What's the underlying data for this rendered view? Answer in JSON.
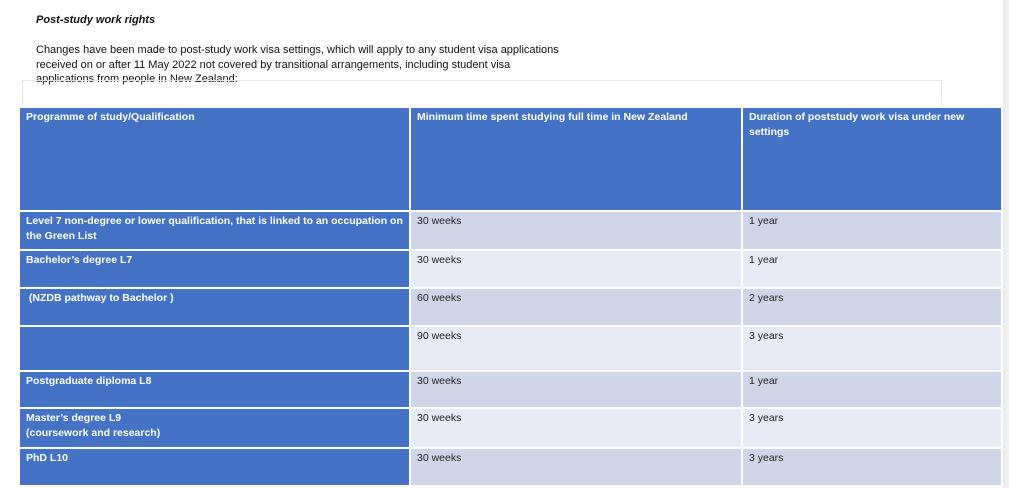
{
  "heading": "Post-study work rights",
  "intro": {
    "line1": "Changes have been made to post-study work visa settings, which will apply to any student visa applications",
    "line2": "received on or after 11 May 2022 not covered by transitional arrangements, including student visa",
    "line3": "applications from people in New Zealand:"
  },
  "table": {
    "headers": [
      "Programme of study/Qualification",
      "Minimum time spent studying full time in New Zealand",
      "Duration of poststudy work visa under new settings"
    ],
    "rows": [
      {
        "qualification": "Level 7 non-degree or lower qualification, that is linked to an occupation on the Green List",
        "min_time": "30 weeks",
        "duration": "1 year"
      },
      {
        "qualification": "Bachelor’s degree L7",
        "min_time": "30 weeks",
        "duration": "1 year"
      },
      {
        "qualification": " (NZDB pathway to Bachelor )",
        "min_time": "60 weeks",
        "duration": "2 years"
      },
      {
        "qualification": "",
        "min_time": "90 weeks",
        "duration": "3 years"
      },
      {
        "qualification": "Postgraduate diploma L8",
        "min_time": "30 weeks",
        "duration": "1 year"
      },
      {
        "qualification_line1": "Master’s degree L9",
        "qualification_line2": "(coursework and research)",
        "min_time": "30 weeks",
        "duration": "3 years"
      },
      {
        "qualification": "PhD L10",
        "min_time": "30 weeks",
        "duration": "3 years"
      }
    ]
  }
}
